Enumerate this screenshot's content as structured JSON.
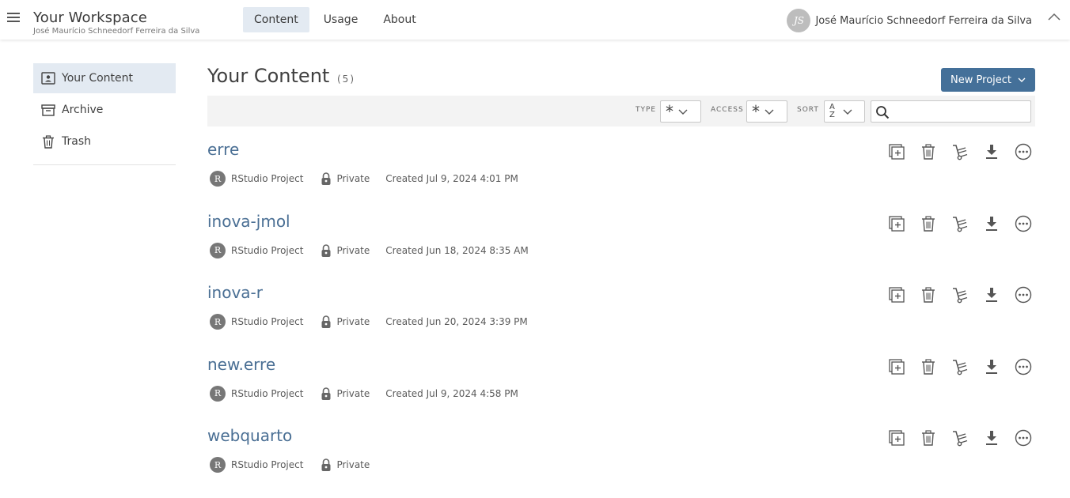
{
  "header": {
    "workspace_title": "Your Workspace",
    "workspace_owner": "José Maurício Schneedorf Ferreira da Silva",
    "tabs": [
      {
        "label": "Content",
        "active": true
      },
      {
        "label": "Usage",
        "active": false
      },
      {
        "label": "About",
        "active": false
      }
    ],
    "user": {
      "initials": "JS",
      "name": "José Maurício Schneedorf Ferreira da Silva"
    }
  },
  "sidebar": {
    "items": [
      {
        "label": "Your Content",
        "icon": "user-card-icon",
        "active": true
      },
      {
        "label": "Archive",
        "icon": "archive-icon",
        "active": false
      },
      {
        "label": "Trash",
        "icon": "trash-icon",
        "active": false
      }
    ]
  },
  "main": {
    "title": "Your Content",
    "count": "(5)",
    "new_project_label": "New Project",
    "filters": {
      "type_label": "TYPE",
      "access_label": "ACCESS",
      "sort_label": "SORT",
      "type_value": "*",
      "access_value": "*",
      "sort_top": "A",
      "sort_bottom": "Z",
      "search_placeholder": ""
    },
    "items": [
      {
        "name": "erre",
        "kind": "RStudio Project",
        "access": "Private",
        "created": "Created Jul 9, 2024 4:01 PM"
      },
      {
        "name": "inova-jmol",
        "kind": "RStudio Project",
        "access": "Private",
        "created": "Created Jun 18, 2024 8:35 AM"
      },
      {
        "name": "inova-r",
        "kind": "RStudio Project",
        "access": "Private",
        "created": "Created Jun 20, 2024 3:39 PM"
      },
      {
        "name": "new.erre",
        "kind": "RStudio Project",
        "access": "Private",
        "created": "Created Jul 9, 2024 4:58 PM"
      },
      {
        "name": "webquarto",
        "kind": "RStudio Project",
        "access": "Private",
        "created": ""
      }
    ],
    "kind_badge": "R"
  },
  "colors": {
    "accent": "#447099",
    "link": "#4a6f94",
    "active_bg": "#e3eaf2",
    "filter_bg": "#f3f3f3"
  }
}
